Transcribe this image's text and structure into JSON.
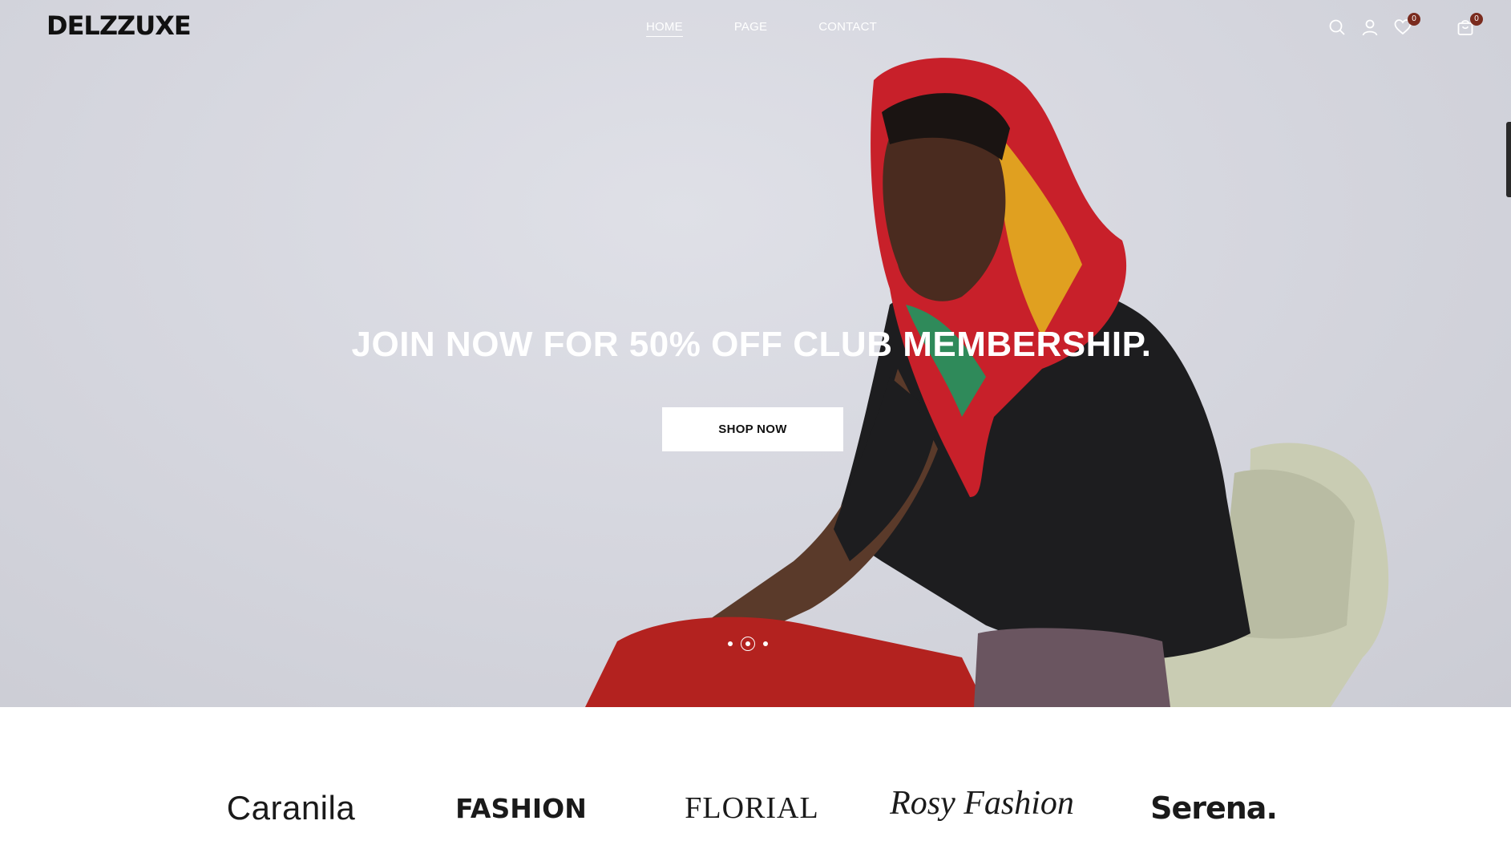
{
  "header": {
    "logo": "DELZZUXE",
    "nav": [
      {
        "label": "HOME",
        "active": true
      },
      {
        "label": "PAGE",
        "active": false
      },
      {
        "label": "CONTACT",
        "active": false
      }
    ],
    "icons": {
      "search": "search-icon",
      "account": "user-icon",
      "wishlist": "heart-icon",
      "cart": "shopping-bag-icon"
    },
    "wishlist_count": "0",
    "cart_count": "0",
    "badge_color": "#7a2b1e"
  },
  "hero": {
    "title": "JOIN NOW FOR 50% OFF CLUB MEMBERSHIP.",
    "cta_label": "SHOP NOW",
    "slides": 3,
    "active_slide": 2
  },
  "brands": [
    "Caranila",
    "FASHION",
    "FLORIAL",
    "Rosy Fashion",
    "Serena."
  ]
}
